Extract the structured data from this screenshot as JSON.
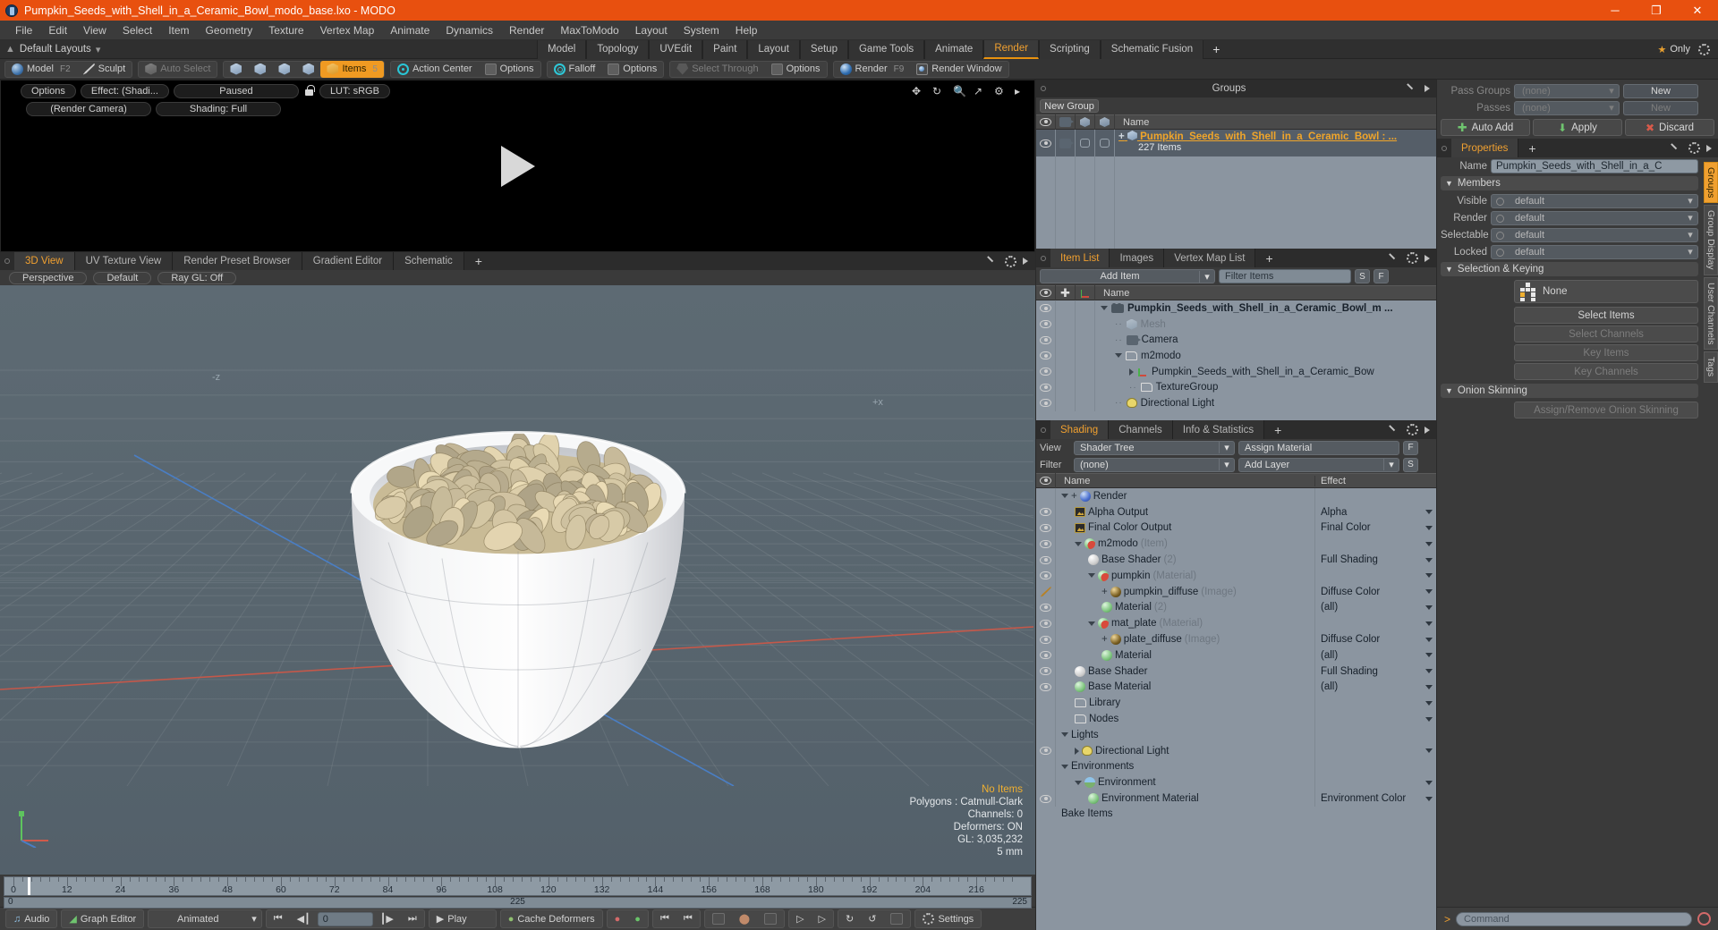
{
  "titlebar": {
    "title": "Pumpkin_Seeds_with_Shell_in_a_Ceramic_Bowl_modo_base.lxo - MODO",
    "minimize": "─",
    "maximize": "❐",
    "close": "✕"
  },
  "menubar": [
    "File",
    "Edit",
    "View",
    "Select",
    "Item",
    "Geometry",
    "Texture",
    "Vertex Map",
    "Animate",
    "Dynamics",
    "Render",
    "MaxToModo",
    "Layout",
    "System",
    "Help"
  ],
  "layoutrow": {
    "layouts_label": "Default Layouts",
    "tabs": [
      {
        "label": "Model",
        "active": false
      },
      {
        "label": "Topology",
        "active": false
      },
      {
        "label": "UVEdit",
        "active": false
      },
      {
        "label": "Paint",
        "active": false
      },
      {
        "label": "Layout",
        "active": false
      },
      {
        "label": "Setup",
        "active": false
      },
      {
        "label": "Game Tools",
        "active": false
      },
      {
        "label": "Animate",
        "active": false
      },
      {
        "label": "Render",
        "active": true
      },
      {
        "label": "Scripting",
        "active": false
      },
      {
        "label": "Schematic Fusion",
        "active": false
      }
    ],
    "plus": "+",
    "only_label": "Only"
  },
  "toolbar": {
    "mode_model": "Model",
    "mode_model_key": "F2",
    "mode_sculpt": "Sculpt",
    "auto_select": "Auto Select",
    "items": "Items",
    "items_key": "5",
    "action_center": "Action Center",
    "options_1": "Options",
    "falloff": "Falloff",
    "options_2": "Options",
    "select_through": "Select Through",
    "options_3": "Options",
    "render": "Render",
    "render_key": "F9",
    "render_window": "Render Window"
  },
  "preview": {
    "options": "Options",
    "effect": "Effect: (Shadi...",
    "paused": "Paused",
    "lut": "LUT: sRGB",
    "render_camera": "(Render Camera)",
    "shading": "Shading: Full"
  },
  "viewport_tabs": {
    "tabs": [
      {
        "label": "3D View",
        "active": true
      },
      {
        "label": "UV Texture View",
        "active": false
      },
      {
        "label": "Render Preset Browser",
        "active": false
      },
      {
        "label": "Gradient Editor",
        "active": false
      },
      {
        "label": "Schematic",
        "active": false
      }
    ],
    "plus": "+",
    "sub": [
      "Perspective",
      "Default",
      "Ray GL: Off"
    ]
  },
  "viewport": {
    "label_minus_z": "-z",
    "label_plus_x": "+x",
    "stats": {
      "no_items": "No Items",
      "polygons": "Polygons : Catmull-Clark",
      "channels": "Channels: 0",
      "deformers": "Deformers: ON",
      "gl": "GL: 3,035,232",
      "scale": "5 mm"
    }
  },
  "timeline": {
    "ticks": [
      0,
      12,
      24,
      36,
      48,
      60,
      72,
      84,
      96,
      108,
      120,
      132,
      144,
      156,
      168,
      180,
      192,
      204,
      216
    ],
    "range_start": "0",
    "range_mid": "225",
    "range_end": "225"
  },
  "transport": {
    "audio": "Audio",
    "graph_editor": "Graph Editor",
    "animated": "Animated",
    "frame_value": "0",
    "play": "Play",
    "cache_deformers": "Cache Deformers",
    "settings": "Settings"
  },
  "groups_panel": {
    "title": "Groups",
    "new_group": "New Group",
    "columns": [
      "Name"
    ],
    "row": {
      "name": "Pumpkin_Seeds_with_Shell_in_a_Ceramic_Bowl : ...",
      "count": "227 Items"
    }
  },
  "item_list": {
    "tabs": [
      {
        "label": "Item List",
        "active": true
      },
      {
        "label": "Images",
        "active": false
      },
      {
        "label": "Vertex Map List",
        "active": false
      }
    ],
    "plus": "+",
    "add_item": "Add Item",
    "filter_placeholder": "Filter Items",
    "btn_s": "S",
    "btn_f": "F",
    "name_col": "Name",
    "rows": [
      {
        "label": "Pumpkin_Seeds_with_Shell_in_a_Ceramic_Bowl_m ...",
        "indent": 0,
        "icon": "camera-film-icon",
        "bold": true,
        "dim": false,
        "twisty": "down"
      },
      {
        "label": "Mesh",
        "indent": 1,
        "icon": "mesh-icon",
        "bold": false,
        "dim": true,
        "twisty": "none"
      },
      {
        "label": "Camera",
        "indent": 1,
        "icon": "camera-icon",
        "bold": false,
        "dim": false,
        "twisty": "none"
      },
      {
        "label": "m2modo",
        "indent": 1,
        "icon": "folder-icon",
        "bold": false,
        "dim": false,
        "twisty": "down"
      },
      {
        "label": "Pumpkin_Seeds_with_Shell_in_a_Ceramic_Bow",
        "indent": 2,
        "icon": "locator-icon",
        "bold": false,
        "dim": false,
        "twisty": "right"
      },
      {
        "label": "TextureGroup",
        "indent": 2,
        "icon": "folder-icon",
        "bold": false,
        "dim": false,
        "twisty": "none"
      },
      {
        "label": "Directional Light",
        "indent": 1,
        "icon": "light-icon",
        "bold": false,
        "dim": false,
        "twisty": "none"
      }
    ]
  },
  "shading_panel": {
    "tabs": [
      {
        "label": "Shading",
        "active": true
      },
      {
        "label": "Channels",
        "active": false
      },
      {
        "label": "Info & Statistics",
        "active": false
      }
    ],
    "plus": "+",
    "view_label": "View",
    "view_value": "Shader Tree",
    "assign_material": "Assign Material",
    "btn_f": "F",
    "filter_label": "Filter",
    "filter_value": "(none)",
    "add_layer": "Add Layer",
    "btn_s": "S",
    "col_name": "Name",
    "col_effect": "Effect",
    "rows": [
      {
        "name": "Render",
        "type": "",
        "effect": "",
        "indent": 0,
        "icon": "blue-ball-icon",
        "eye": false,
        "twisty": "down",
        "plus": true
      },
      {
        "name": "Alpha Output",
        "type": "",
        "effect": "Alpha",
        "indent": 1,
        "icon": "image-output-icon",
        "eye": true,
        "twisty": "none"
      },
      {
        "name": "Final Color Output",
        "type": "",
        "effect": "Final Color",
        "indent": 1,
        "icon": "image-output-icon",
        "eye": true,
        "twisty": "none"
      },
      {
        "name": "m2modo",
        "type": "(Item)",
        "effect": "",
        "indent": 1,
        "icon": "material-group-icon",
        "eye": true,
        "twisty": "down"
      },
      {
        "name": "Base Shader",
        "type": "(2)",
        "effect": "Full Shading",
        "indent": 2,
        "icon": "white-ball-icon",
        "eye": true,
        "twisty": "none"
      },
      {
        "name": "pumpkin",
        "type": "(Material)",
        "effect": "",
        "indent": 2,
        "icon": "material-group-icon",
        "eye": true,
        "twisty": "down"
      },
      {
        "name": "pumpkin_diffuse",
        "type": "(Image)",
        "effect": "Diffuse Color",
        "indent": 3,
        "icon": "image-ball-icon",
        "eye": false,
        "brush": true,
        "twisty": "none",
        "plus": true
      },
      {
        "name": "Material",
        "type": "(2)",
        "effect": "(all)",
        "indent": 3,
        "icon": "green-ball-icon",
        "eye": true,
        "twisty": "none"
      },
      {
        "name": "mat_plate",
        "type": "(Material)",
        "effect": "",
        "indent": 2,
        "icon": "material-group-icon",
        "eye": true,
        "twisty": "down"
      },
      {
        "name": "plate_diffuse",
        "type": "(Image)",
        "effect": "Diffuse Color",
        "indent": 3,
        "icon": "image-ball-icon",
        "eye": true,
        "twisty": "none",
        "plus": true
      },
      {
        "name": "Material",
        "type": "",
        "effect": "(all)",
        "indent": 3,
        "icon": "green-ball-icon",
        "eye": true,
        "twisty": "none"
      },
      {
        "name": "Base Shader",
        "type": "",
        "effect": "Full Shading",
        "indent": 1,
        "icon": "white-ball-icon",
        "eye": true,
        "twisty": "none"
      },
      {
        "name": "Base Material",
        "type": "",
        "effect": "(all)",
        "indent": 1,
        "icon": "green-ball-icon",
        "eye": true,
        "twisty": "none"
      },
      {
        "name": "Library",
        "type": "",
        "effect": "",
        "indent": 1,
        "icon": "folder-icon",
        "eye": false,
        "twisty": "none"
      },
      {
        "name": "Nodes",
        "type": "",
        "effect": "",
        "indent": 1,
        "icon": "folder-icon",
        "eye": false,
        "twisty": "none"
      },
      {
        "name": "Lights",
        "type": "",
        "effect": "",
        "indent": 0,
        "icon": "none",
        "eye": false,
        "twisty": "down"
      },
      {
        "name": "Directional Light",
        "type": "",
        "effect": "",
        "indent": 1,
        "icon": "light-icon",
        "eye": true,
        "twisty": "right"
      },
      {
        "name": "Environments",
        "type": "",
        "effect": "",
        "indent": 0,
        "icon": "none",
        "eye": false,
        "twisty": "down"
      },
      {
        "name": "Environment",
        "type": "",
        "effect": "",
        "indent": 1,
        "icon": "environment-icon",
        "eye": false,
        "twisty": "down"
      },
      {
        "name": "Environment Material",
        "type": "",
        "effect": "Environment Color",
        "indent": 2,
        "icon": "green-ball-icon",
        "eye": true,
        "twisty": "none"
      }
    ],
    "bake_items": "Bake Items"
  },
  "properties_panel": {
    "pass_groups_label": "Pass Groups",
    "pass_groups_value": "(none)",
    "pass_groups_new": "New",
    "passes_label": "Passes",
    "passes_value": "(none)",
    "passes_new": "New",
    "auto_add": "Auto Add",
    "apply": "Apply",
    "discard": "Discard",
    "tabs": [
      {
        "label": "Properties",
        "active": true
      }
    ],
    "plus": "+",
    "name_label": "Name",
    "name_value": "Pumpkin_Seeds_with_Shell_in_a_C",
    "members_header": "Members",
    "members": [
      {
        "label": "Visible",
        "value": "default"
      },
      {
        "label": "Render",
        "value": "default"
      },
      {
        "label": "Selectable",
        "value": "default"
      },
      {
        "label": "Locked",
        "value": "default"
      }
    ],
    "selection_keying_header": "Selection & Keying",
    "selection_value": "None",
    "buttons": [
      {
        "label": "Select Items",
        "enabled": true
      },
      {
        "label": "Select Channels",
        "enabled": false
      },
      {
        "label": "Key Items",
        "enabled": false
      },
      {
        "label": "Key Channels",
        "enabled": false
      }
    ],
    "onion_header": "Onion Skinning",
    "onion_button": "Assign/Remove Onion Skinning",
    "side_tabs": [
      {
        "label": "Groups",
        "active": true
      },
      {
        "label": "Group Display",
        "active": false
      },
      {
        "label": "User Channels",
        "active": false
      },
      {
        "label": "Tags",
        "active": false
      }
    ]
  },
  "command_bar": {
    "prompt": ">",
    "placeholder": "Command"
  },
  "colors": {
    "accent_orange": "#f0a030",
    "title_orange": "#e8500f",
    "panel_bg": "#3a3a3a",
    "list_bg": "#8b95a0"
  }
}
